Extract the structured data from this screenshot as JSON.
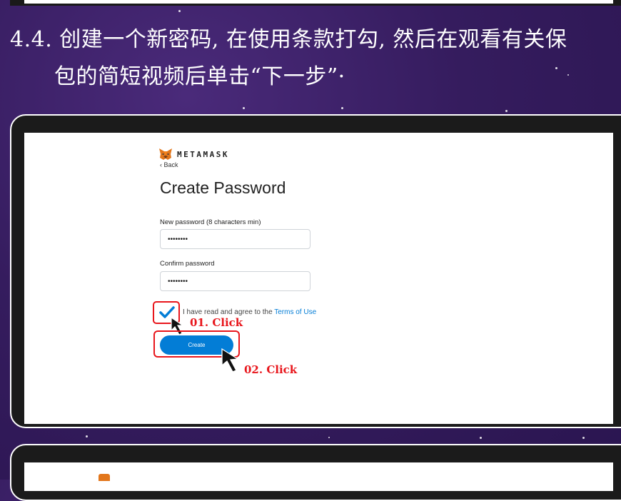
{
  "heading": {
    "line1": "4.4. 创建一个新密码, 在使用条款打勾, 然后在观看有关保",
    "line2": "包的简短视频后单击“下一步”·"
  },
  "app": {
    "brand": "METAMASK",
    "back_label": "‹ Back",
    "title": "Create Password",
    "new_password_label": "New password (8 characters min)",
    "new_password_value": "••••••••",
    "confirm_password_label": "Confirm password",
    "confirm_password_value": "••••••••",
    "agree_text": "I have read and agree to the ",
    "terms_link": "Terms of Use",
    "create_button": "Create"
  },
  "annotations": {
    "step1": "01. Click",
    "step2": "02. Click"
  },
  "colors": {
    "background": "#351c5e",
    "accent": "#037dd6",
    "highlight": "#e8161c"
  }
}
